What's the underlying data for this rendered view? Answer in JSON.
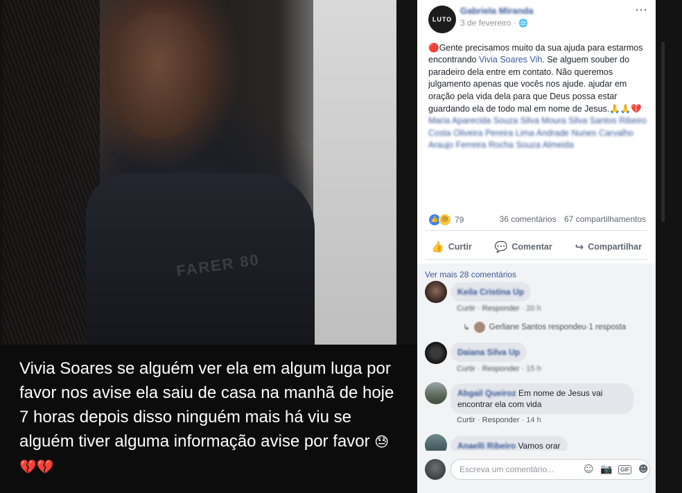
{
  "photo": {
    "shirt_text": "FARER 80",
    "caption": "Vivia Soares se alguém ver ela em algum luga por favor nos avise ela saiu de casa na manhã de hoje 7 horas depois disso ninguém mais há viu se alguém tiver alguma informação avise por favor",
    "caption_emoji": "😓💔💔"
  },
  "post": {
    "avatar_text": "LUTO",
    "author": "Gabriela Miranda",
    "date": "3 de fevereiro",
    "date_separator": " · ",
    "globe_icon": "🌐",
    "more_icon": "⋯",
    "text_alert_emoji": "🔴",
    "text_part1": "Gente precisamos muito da sua ajuda para estarmos encontrando ",
    "mention": "Vivia Soares Vih",
    "text_part2": ". Se alguem souber do paradeiro dela entre em contato. Não queremos julgamento apenas que vocês nos ajude. ajudar em oração pela vida dela para que Deus possa estar guardando ela de todo mal em nome de Jesus.",
    "text_emoji": "🙏🙏💔",
    "tagged_names": "Maria Aparecida Souza Silva Moura Silva Santos Ribeiro Costa Oliveira Pereira Lima Andrade Nunes Carvalho Araujo Ferreira Rocha Souza Almeida"
  },
  "reactions": {
    "like_icon": "👍",
    "sad_icon": "😢",
    "count": "79",
    "comments": "36 comentários",
    "shares": "67 compartilhamentos"
  },
  "actions": {
    "like": {
      "icon": "👍",
      "label": "Curtir"
    },
    "comment": {
      "icon": "💬",
      "label": "Comentar"
    },
    "share": {
      "icon": "↪",
      "label": "Compartilhar"
    }
  },
  "comments_section": {
    "see_more": "Ver mais 28 comentários",
    "comments": [
      {
        "name": "Keila Cristina",
        "text": "Up",
        "like": "Curtir",
        "reply": "Responder",
        "time": "20 h"
      },
      {
        "name": "Daiana Silva",
        "text": "Up",
        "like": "Curtir",
        "reply": "Responder",
        "time": "15 h"
      },
      {
        "name": "Abgail Queiroz",
        "text": "Em nome de Jesus vai encontrar ela com vida",
        "like": "Curtir",
        "reply": "Responder",
        "time": "14 h"
      },
      {
        "name": "Anaelli Ribeiro",
        "text": "Vamos orar"
      }
    ],
    "reply_summary": {
      "arrow": "↳",
      "text": "Gerliane Santos respondeu",
      "separator": " · ",
      "count": "1 resposta"
    },
    "meta_separator": " · "
  },
  "composer": {
    "placeholder": "Escreva um comentário...",
    "emoji_icon": "☺",
    "camera_icon": "📷",
    "gif_label": "GIF",
    "sticker_icon": "☻"
  }
}
